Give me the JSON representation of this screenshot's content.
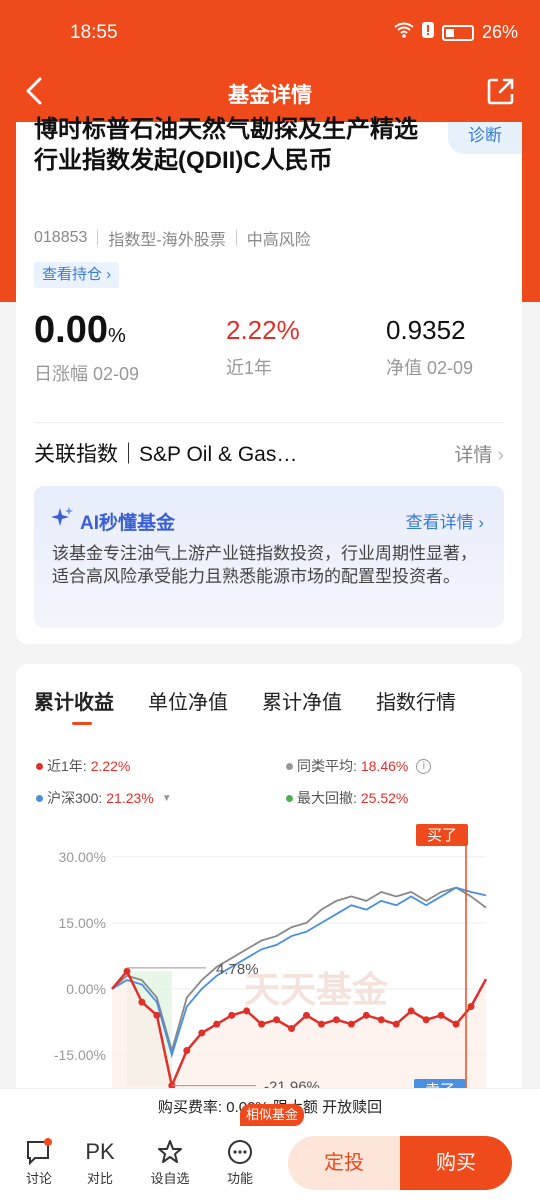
{
  "status": {
    "time": "18:55",
    "battery": "26%"
  },
  "nav": {
    "title": "基金详情"
  },
  "fund": {
    "name": "博时标普石油天然气勘探及生产精选行业指数发起(QDII)C人民币",
    "diagnose": "诊断",
    "code": "018853",
    "type": "指数型-海外股票",
    "risk": "中高风险",
    "holdings": "查看持仓 ›",
    "daily_change": "0.00",
    "daily_change_unit": "%",
    "daily_label": "日涨幅 02-09",
    "year_return": "2.22%",
    "year_label": "近1年",
    "nav_value": "0.9352",
    "nav_label": "净值 02-09",
    "related_index": "关联指数｜S&P Oil & Gas…",
    "related_detail": "详情"
  },
  "ai": {
    "title": "AI秒懂基金",
    "link": "查看详情",
    "text": "该基金专注油气上游产业链指数投资，行业周期性显著，适合高风险承受能力且熟悉能源市场的配置型投资者。"
  },
  "chart_tabs": [
    "累计收益",
    "单位净值",
    "累计净值",
    "指数行情"
  ],
  "legend": {
    "fund_label": "近1年:",
    "fund_value": "2.22%",
    "peer_label": "同类平均:",
    "peer_value": "18.46%",
    "csi_label": "沪深300:",
    "csi_value": "21.23%",
    "drawdown_label": "最大回撤:",
    "drawdown_value": "25.52%"
  },
  "colors": {
    "accent": "#ee4a1c",
    "fund": "#e0302a",
    "peer": "#888888",
    "csi": "#4a90e2",
    "drawdown": "#4caf50"
  },
  "chart_data": {
    "type": "line",
    "title": "",
    "xlabel": "",
    "ylabel": "",
    "yticks": [
      "30.00%",
      "15.00%",
      "0.00%",
      "-15.00%"
    ],
    "ylim": [
      -25,
      32
    ],
    "annotations": [
      "4.78%",
      "-21.96%",
      "买了",
      "卖了"
    ],
    "watermark": "天天基金",
    "x": [
      0,
      4,
      8,
      12,
      16,
      20,
      24,
      28,
      32,
      36,
      40,
      44,
      48,
      52,
      56,
      60,
      64,
      68,
      72,
      76,
      80,
      84,
      88,
      92,
      96,
      100
    ],
    "series": [
      {
        "name": "近1年",
        "values": [
          0,
          4,
          -3,
          -6,
          -21.96,
          -14,
          -10,
          -8,
          -6,
          -5,
          -8,
          -7,
          -9,
          -6,
          -8,
          -7,
          -8,
          -6,
          -7,
          -8,
          -5,
          -7,
          -6,
          -8,
          -4,
          2.22
        ]
      },
      {
        "name": "同类平均",
        "values": [
          0,
          3,
          2,
          -2,
          -14,
          -2,
          2,
          5,
          7,
          9,
          11,
          12,
          14,
          15,
          18,
          20,
          21,
          20,
          22,
          21,
          22,
          20,
          22,
          23,
          21,
          18.46
        ]
      },
      {
        "name": "沪深300",
        "values": [
          0,
          2,
          1,
          -3,
          -15,
          -4,
          0,
          3,
          5,
          7,
          9,
          10,
          12,
          13,
          15,
          17,
          19,
          18,
          20,
          19,
          21,
          19,
          21,
          23,
          22,
          21.23
        ]
      }
    ]
  },
  "bottom_note": "购买费率: 0.00%  限大额  开放赎回",
  "toolbar": {
    "discuss": "讨论",
    "compare_icon": "PK",
    "compare": "对比",
    "watch": "设自选",
    "features": "功能",
    "similar": "相似基金",
    "dingtou": "定投",
    "buy": "购买"
  }
}
